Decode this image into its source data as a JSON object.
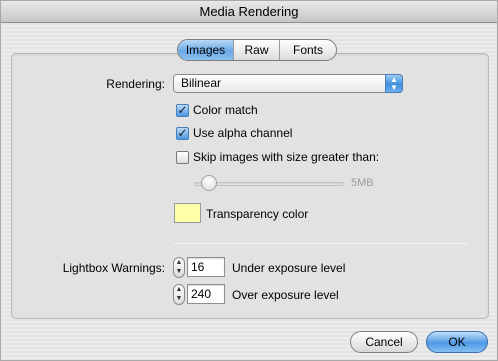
{
  "window": {
    "title": "Media Rendering"
  },
  "tabs": [
    {
      "label": "Images",
      "active": true
    },
    {
      "label": "Raw",
      "active": false
    },
    {
      "label": "Fonts",
      "active": false
    }
  ],
  "rendering": {
    "label": "Rendering:",
    "selected": "Bilinear"
  },
  "checkboxes": {
    "color_match": {
      "label": "Color match",
      "checked": true
    },
    "alpha_channel": {
      "label": "Use alpha channel",
      "checked": true
    },
    "skip_images": {
      "label": "Skip images with size greater than:",
      "checked": false
    }
  },
  "size_slider": {
    "value_label": "5MB"
  },
  "transparency": {
    "label": "Transparency color",
    "color": "#ffffaa"
  },
  "lightbox": {
    "label": "Lightbox Warnings:",
    "under": {
      "value": "16",
      "label": "Under exposure level"
    },
    "over": {
      "value": "240",
      "label": "Over exposure level"
    }
  },
  "buttons": {
    "cancel": "Cancel",
    "ok": "OK"
  },
  "colors": {
    "accent": "#4d9ae6"
  }
}
